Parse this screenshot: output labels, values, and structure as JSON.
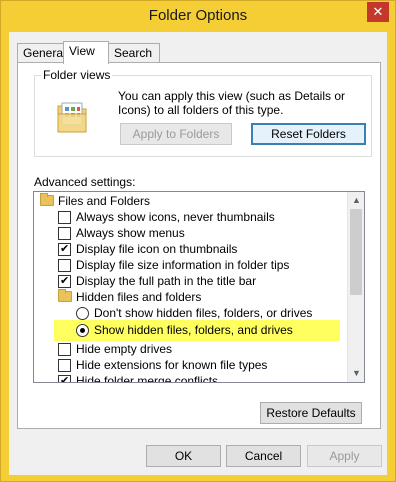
{
  "window": {
    "title": "Folder Options",
    "close_glyph": "✕"
  },
  "tabs": [
    {
      "label": "General"
    },
    {
      "label": "View"
    },
    {
      "label": "Search"
    }
  ],
  "folder_views": {
    "group_label": "Folder views",
    "description": "You can apply this view (such as Details or Icons) to all folders of this type.",
    "apply_label": "Apply to Folders",
    "reset_label": "Reset Folders"
  },
  "advanced": {
    "label": "Advanced settings:",
    "items": [
      {
        "type": "folder",
        "label": "Files and Folders"
      },
      {
        "type": "checkbox",
        "checked": false,
        "label": "Always show icons, never thumbnails"
      },
      {
        "type": "checkbox",
        "checked": false,
        "label": "Always show menus"
      },
      {
        "type": "checkbox",
        "checked": true,
        "label": "Display file icon on thumbnails"
      },
      {
        "type": "checkbox",
        "checked": false,
        "label": "Display file size information in folder tips"
      },
      {
        "type": "checkbox",
        "checked": true,
        "label": "Display the full path in the title bar"
      },
      {
        "type": "folder",
        "label": "Hidden files and folders"
      },
      {
        "type": "radio",
        "checked": false,
        "label": "Don't show hidden files, folders, or drives"
      },
      {
        "type": "radio",
        "checked": true,
        "label": "Show hidden files, folders, and drives"
      },
      {
        "type": "checkbox",
        "checked": false,
        "label": "Hide empty drives"
      },
      {
        "type": "checkbox",
        "checked": false,
        "label": "Hide extensions for known file types"
      },
      {
        "type": "checkbox",
        "checked": true,
        "label": "Hide folder merge conflicts"
      }
    ],
    "highlight_color": "#ffff60"
  },
  "restore_label": "Restore Defaults",
  "footer": {
    "ok": "OK",
    "cancel": "Cancel",
    "apply": "Apply"
  },
  "colors": {
    "frame": "#f5ce36",
    "close": "#c4372b"
  }
}
